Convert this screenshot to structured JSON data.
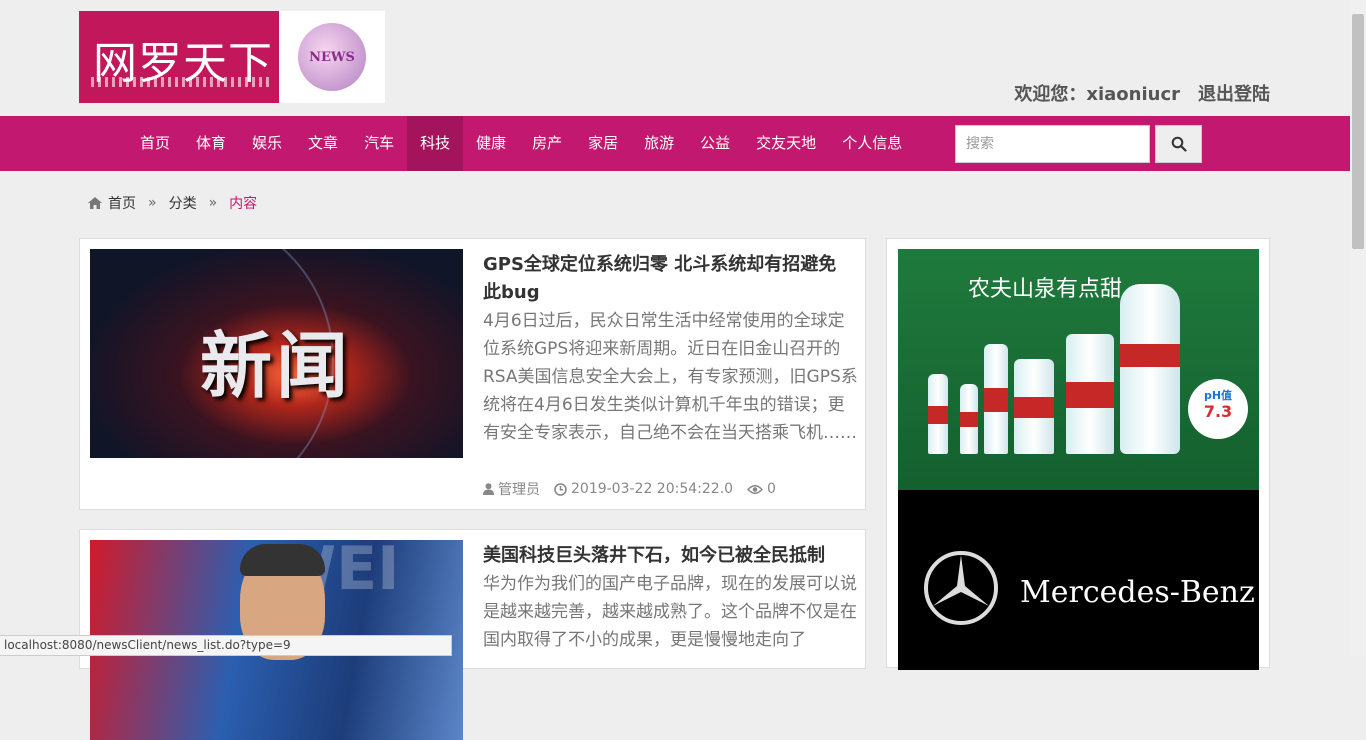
{
  "header": {
    "logo_text": "网罗天下",
    "logo_badge": "NEWS",
    "welcome": "欢迎您：xiaoniucr",
    "logout": "退出登陆"
  },
  "nav": {
    "items": [
      "首页",
      "体育",
      "娱乐",
      "文章",
      "汽车",
      "科技",
      "健康",
      "房产",
      "家居",
      "旅游",
      "公益",
      "交友天地",
      "个人信息"
    ],
    "active_index": 5,
    "search_placeholder": "搜索"
  },
  "breadcrumb": {
    "home": "首页",
    "sep": "»",
    "category": "分类",
    "current": "内容"
  },
  "articles": [
    {
      "thumb_text": "新闻",
      "title": "GPS全球定位系统归零 北斗系统却有招避免此bug",
      "summary": "4月6日过后，民众日常生活中经常使用的全球定位系统GPS将迎来新周期。近日在旧金山召开的RSA美国信息安全大会上，有专家预测，旧GPS系统将在4月6日发生类似计算机千年虫的错误；更有安全专家表示，自己绝不会在当天搭乘飞机……",
      "author": "管理员",
      "time": "2019-03-22 20:54:22.0",
      "views": "0"
    },
    {
      "thumb_text": "WEI",
      "title": "美国科技巨头落井下石，如今已被全民抵制",
      "summary": "华为作为我们的国产电子品牌，现在的发展可以说是越来越完善，越来越成熟了。这个品牌不仅是在国内取得了不小的成果，更是慢慢地走向了"
    }
  ],
  "ads": {
    "water_slogan": "农夫山泉有点甜",
    "water_ph_label": "pH值",
    "water_ph_value": "7.3",
    "car_brand": "Mercedes-Benz"
  },
  "statusbar": "localhost:8080/newsClient/news_list.do?type=9",
  "colors": {
    "brand": "#c2186f",
    "nav_active": "#a3145d"
  }
}
